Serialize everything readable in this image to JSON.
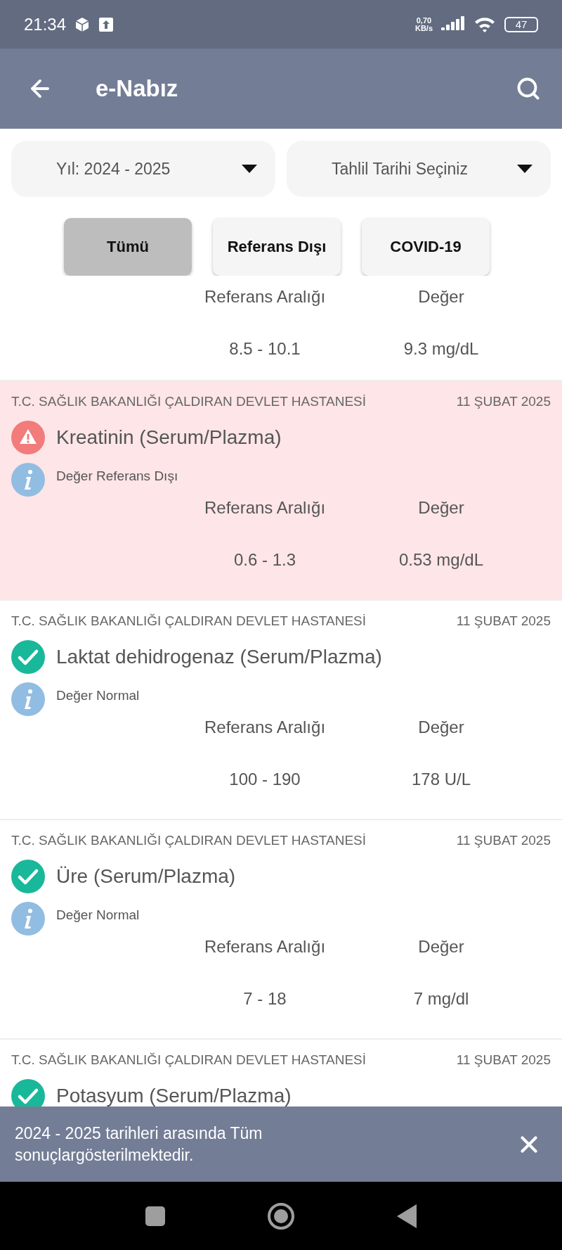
{
  "status_bar": {
    "time": "21:34",
    "speed_value": "0,70",
    "speed_unit": "KB/s",
    "battery": "47"
  },
  "app_bar": {
    "title": "e-Nabız"
  },
  "dropdowns": [
    {
      "label": "Yıl: 2024 - 2025"
    },
    {
      "label": "Tahlil Tarihi Seçiniz"
    }
  ],
  "filters": [
    {
      "label": "Tümü",
      "selected": true
    },
    {
      "label": "Referans Dışı",
      "selected": false
    },
    {
      "label": "COVID-19",
      "selected": false
    }
  ],
  "results": [
    {
      "out_of_range": false,
      "range_label": "Referans Aralığı",
      "value_label": "Değer",
      "range": "8.5 - 10.1",
      "value": "9.3 mg/dL"
    },
    {
      "out_of_range": true,
      "hospital": "T.C. SAĞLIK BAKANLIĞI ÇALDIRAN DEVLET HASTANESİ",
      "date": "11 ŞUBAT 2025",
      "test": "Kreatinin (Serum/Plazma)",
      "note": "Değer Referans Dışı",
      "range_label": "Referans Aralığı",
      "value_label": "Değer",
      "range": "0.6 - 1.3",
      "value": "0.53 mg/dL"
    },
    {
      "out_of_range": false,
      "hospital": "T.C. SAĞLIK BAKANLIĞI ÇALDIRAN DEVLET HASTANESİ",
      "date": "11 ŞUBAT 2025",
      "test": "Laktat dehidrogenaz (Serum/Plazma)",
      "note": "Değer Normal",
      "range_label": "Referans Aralığı",
      "value_label": "Değer",
      "range": "100 - 190",
      "value": "178 U/L"
    },
    {
      "out_of_range": false,
      "hospital": "T.C. SAĞLIK BAKANLIĞI ÇALDIRAN DEVLET HASTANESİ",
      "date": "11 ŞUBAT 2025",
      "test": "Üre (Serum/Plazma)",
      "note": "Değer Normal",
      "range_label": "Referans Aralığı",
      "value_label": "Değer",
      "range": "7 - 18",
      "value": "7 mg/dl"
    },
    {
      "out_of_range": false,
      "hospital": "T.C. SAĞLIK BAKANLIĞI ÇALDIRAN DEVLET HASTANESİ",
      "date": "11 ŞUBAT 2025",
      "test": "Potasyum (Serum/Plazma)"
    }
  ],
  "snackbar": {
    "message": "2024 - 2025 tarihleri arasında Tüm sonuçlargösterilmektedir."
  }
}
